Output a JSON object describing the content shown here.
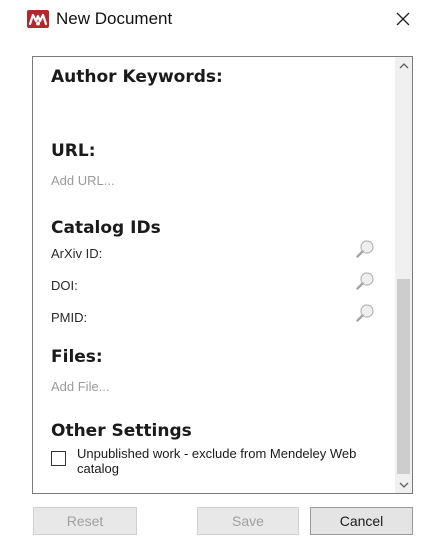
{
  "window": {
    "title": "New Document",
    "logo_icon": "mendeley-logo-icon",
    "close_icon": "close-icon",
    "brand_color": "#b3282d"
  },
  "sections": {
    "author_keywords": "Author Keywords:",
    "url": {
      "title": "URL:",
      "placeholder": "Add URL..."
    },
    "catalog_ids": {
      "title": "Catalog IDs",
      "fields": [
        {
          "label": "ArXiv ID:",
          "icon": "magnifier-icon"
        },
        {
          "label": "DOI:",
          "icon": "magnifier-icon"
        },
        {
          "label": "PMID:",
          "icon": "magnifier-icon"
        }
      ]
    },
    "files": {
      "title": "Files:",
      "placeholder": "Add File..."
    },
    "other_settings": {
      "title": "Other Settings",
      "unpublished_label": "Unpublished work - exclude from Mendeley Web catalog",
      "unpublished_checked": false
    }
  },
  "buttons": {
    "reset": "Reset",
    "save": "Save",
    "cancel": "Cancel"
  }
}
